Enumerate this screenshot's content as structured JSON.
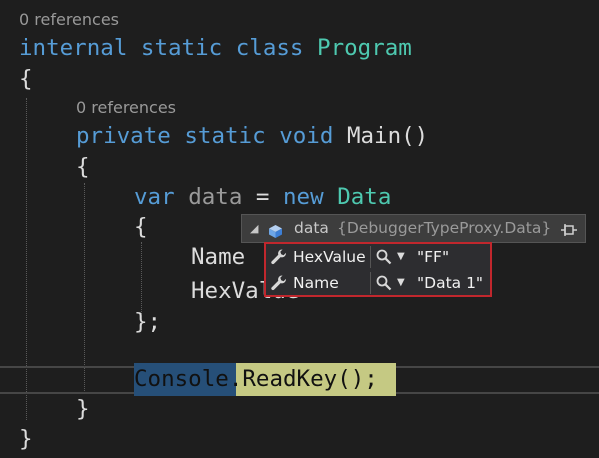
{
  "code_lens": {
    "class_refs": "0 references",
    "method_refs": "0 references"
  },
  "code": {
    "internal": "internal",
    "static1": "static",
    "class": "class",
    "class_name": "Program",
    "open_brace1": "{",
    "private": "private",
    "static2": "static",
    "void": "void",
    "method_sig": "Main()",
    "open_brace2": "{",
    "var": "var",
    "data_var": "data",
    "equals": "=",
    "new": "new",
    "data_type": "Data",
    "open_brace3": "{",
    "name_prop": "Name",
    "hexvalue_prop": "HexValue",
    "close_init": "};",
    "console": "Console",
    "readkey": ".ReadKey();",
    "close_brace2": "}",
    "close_brace1": "}"
  },
  "datatip": {
    "expander_glyph": "◢",
    "variable_name": "data",
    "variable_value": "{DebuggerTypeProxy.Data}",
    "items": [
      {
        "name": "HexValue",
        "value": "\"FF\""
      },
      {
        "name": "Name",
        "value": "\"Data 1\""
      }
    ],
    "dropdown_glyph": "▼"
  },
  "colors": {
    "background": "#1e1e1e",
    "keyword": "#569cd6",
    "type": "#4ec9b0",
    "text": "#dcdcdc",
    "selection": "#264f78",
    "highlight": "#c5c983",
    "datatip_border": "#c1272d"
  },
  "icons": {
    "object": "object-icon",
    "pin": "pin-icon",
    "property": "wrench-icon",
    "visualizer": "magnifier-icon"
  }
}
